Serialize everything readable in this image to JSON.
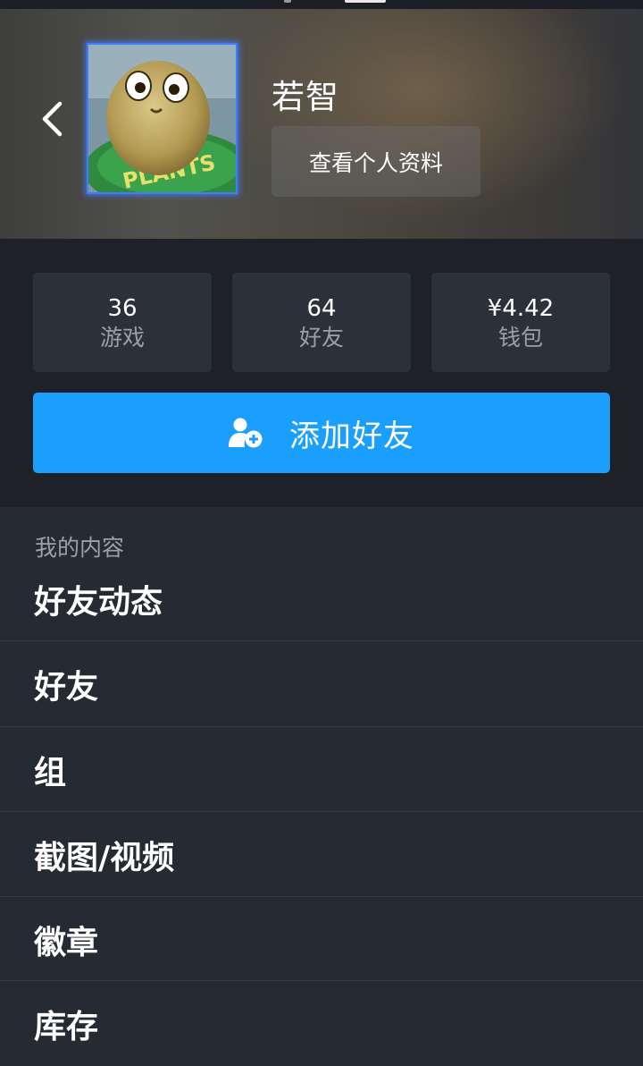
{
  "profile": {
    "username": "若智",
    "view_profile_label": "查看个人资料",
    "avatar_icon": "plant-avatar"
  },
  "stats": [
    {
      "value": "36",
      "label": "游戏"
    },
    {
      "value": "64",
      "label": "好友"
    },
    {
      "value": "¥4.42",
      "label": "钱包"
    }
  ],
  "add_friend": {
    "label": "添加好友",
    "icon": "add-user-icon"
  },
  "content": {
    "section_title": "我的内容",
    "items": [
      {
        "label": "好友动态"
      },
      {
        "label": "好友"
      },
      {
        "label": "组"
      },
      {
        "label": "截图/视频"
      },
      {
        "label": "徽章"
      },
      {
        "label": "库存"
      }
    ]
  },
  "colors": {
    "accent": "#1a9fff",
    "background": "#262a33",
    "stats_background": "#1e2128",
    "card": "#2c303a"
  }
}
